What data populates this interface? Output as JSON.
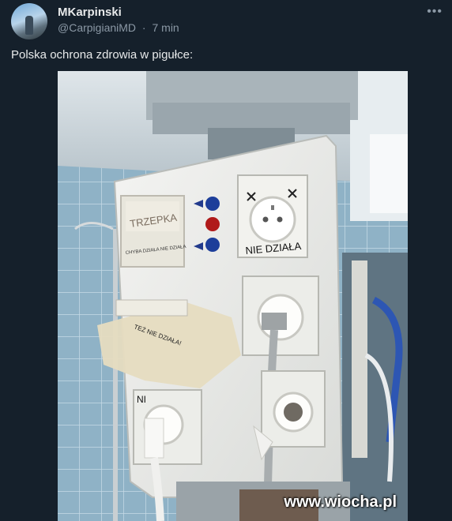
{
  "author": {
    "name": "MKarpinski",
    "handle": "@CarpigianiMD",
    "separator": "·",
    "time": "7 min"
  },
  "tweet": {
    "text": "Polska ochrona zdrowia w pigułce:"
  },
  "media": {
    "label_tape_top": "TRZEPKA",
    "label_tape_top_note": "CHYBA DZIAŁA NIE DZIAŁA",
    "label_socket": "NIE DZIAŁA",
    "label_tape_mid": "TEŻ NIE DZIAŁA!",
    "label_bottom_left": "NI",
    "watermark": "www.wiocha.pl"
  },
  "icons": {
    "more": "more-icon",
    "avatar": "avatar"
  }
}
